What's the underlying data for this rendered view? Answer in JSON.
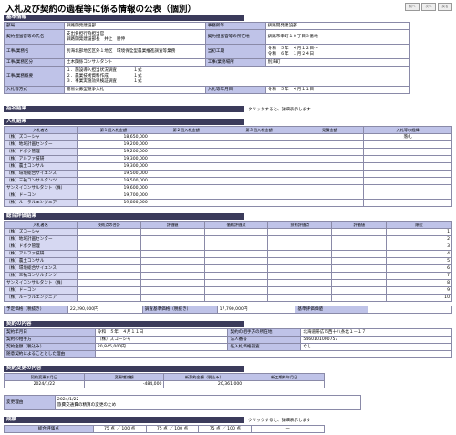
{
  "page_title": "入札及び契約の過程等に係る情報の公表（個別）",
  "nav": [
    "前へ",
    "次へ",
    "戻る"
  ],
  "basic": {
    "section": "基本情報",
    "dept_label": "部局",
    "dept": "釧路開発建設部",
    "office_label": "事務所等",
    "office": "釧路開発建設部",
    "officer_label": "契約担当官等の氏名",
    "officer_line1": "支出負担行為担当官",
    "officer_line2": "釧路開発建設部長　井上　勝伸",
    "address_label": "契約担当官等の所在地",
    "address": "釧路市幸町１０丁目３番地",
    "work_name_label": "工事/業務名",
    "work_name": "別海北部地区区外１地区　環境保全型農業推進調査等業務",
    "period_label": "当初工期",
    "period_line1": "令和　５年　４月１２日～",
    "period_line2": "令和　６年　１月２４日",
    "category_label": "工事/業務区分",
    "category": "土木関係コンサルタント",
    "place_label": "工事/業務場所",
    "place": "別海町",
    "summary_label": "工事/業務概要",
    "summary": [
      "１．施設導入担当状況調査　　　　１式",
      "２．農業技術資料作成　　　　　　１式",
      "３．事業実施効果検証調査　　　　１式"
    ],
    "method_label": "入札等方式",
    "method": "簡易公募型競争入札",
    "bid_date_label": "入札等年月日",
    "bid_date": "令和　５年　４月１１日"
  },
  "nomination": {
    "section": "指名結果",
    "hint": "クリックすると、詳細表示します"
  },
  "bids": {
    "section": "入札結果",
    "headers": [
      "入札者名",
      "第１回入札金額",
      "第２回入札金額",
      "第３回入札金額",
      "見積金額",
      "入札等の経緯"
    ],
    "rows": [
      {
        "name": "（株）ズコーシャ",
        "r1": "18,650,000",
        "note": "落札"
      },
      {
        "name": "（株）地域計画センター",
        "r1": "19,200,000",
        "note": ""
      },
      {
        "name": "（株）ドボク管理",
        "r1": "19,200,000",
        "note": ""
      },
      {
        "name": "（株）アルファ技研",
        "r1": "19,300,000",
        "note": ""
      },
      {
        "name": "（株）農土コンサル",
        "r1": "19,300,000",
        "note": ""
      },
      {
        "name": "（株）環境総合サイエンス",
        "r1": "19,500,000",
        "note": ""
      },
      {
        "name": "（株）三祐コンサルタンツ",
        "r1": "19,500,000",
        "note": ""
      },
      {
        "name": "サンスイコンサルタント（株）",
        "r1": "19,600,000",
        "note": ""
      },
      {
        "name": "（株）ドーコン",
        "r1": "19,700,000",
        "note": ""
      },
      {
        "name": "（株）ルーラルエンジニア",
        "r1": "19,800,000",
        "note": ""
      }
    ]
  },
  "evaluation": {
    "section": "総合評価結果",
    "headers": [
      "入札者名",
      "技術点の合計",
      "評価値",
      "価格評価点",
      "技術評価点",
      "評価値",
      "順位"
    ],
    "rows": [
      {
        "name": "（株）ズコーシャ",
        "rank": "1"
      },
      {
        "name": "（株）地域計画センター",
        "rank": "2"
      },
      {
        "name": "（株）ドボク管理",
        "rank": "3"
      },
      {
        "name": "（株）アルファ技研",
        "rank": "4"
      },
      {
        "name": "（株）農土コンサル",
        "rank": "5"
      },
      {
        "name": "（株）環境総合サイエンス",
        "rank": "6"
      },
      {
        "name": "（株）三祐コンサルタンツ",
        "rank": "7"
      },
      {
        "name": "サンスイコンサルタント（株）",
        "rank": "8"
      },
      {
        "name": "（株）ドーコン",
        "rank": "9"
      },
      {
        "name": "（株）ルーラルエンジニア",
        "rank": "10"
      }
    ],
    "est_label": "予定価格（税抜き）",
    "est": "22,290,000円",
    "survey_label": "調査基準価格（税抜き）",
    "survey": "17,790,000円",
    "std_label": "基準評価価値",
    "std": ""
  },
  "contract": {
    "section": "契約の内容",
    "date_label": "契約年月日",
    "date": "令和　５年　４月１１日",
    "addr_label": "契約の相手方の所在地",
    "addr": "北海道帯広市西十八条北１－１７",
    "partner_label": "契約の相手方",
    "partner": "（株）ズコーシャ",
    "corp_label": "法人番号",
    "corp": "5460101000757",
    "amount_label": "契約金額（税込み）",
    "amount": "20,845,000円",
    "low_label": "低入札価格調査",
    "low": "なし",
    "free_label": "随意契約によることとした理由",
    "free": ""
  },
  "change": {
    "section": "契約変更の内容",
    "headers": [
      "契約変更年月日",
      "変更増減額",
      "新契約金額（税込み）",
      "新工期終年月日"
    ],
    "row": {
      "date": "2024/1/22",
      "diff": "-484,000",
      "new_amount": "20,361,000",
      "new_end": ""
    },
    "reason_label": "変更理由",
    "reason_date": "2024/1/22",
    "reason": "旅費交通費の精算の変更のため"
  },
  "score": {
    "section": "成績",
    "hint": "クリックすると、詳細表示します",
    "headers": [
      "総合評価点"
    ],
    "values": [
      "75 点 ／ 100 点",
      "75 点 ／ 100 点",
      "75 点 ／ 100 点",
      "ー"
    ]
  }
}
